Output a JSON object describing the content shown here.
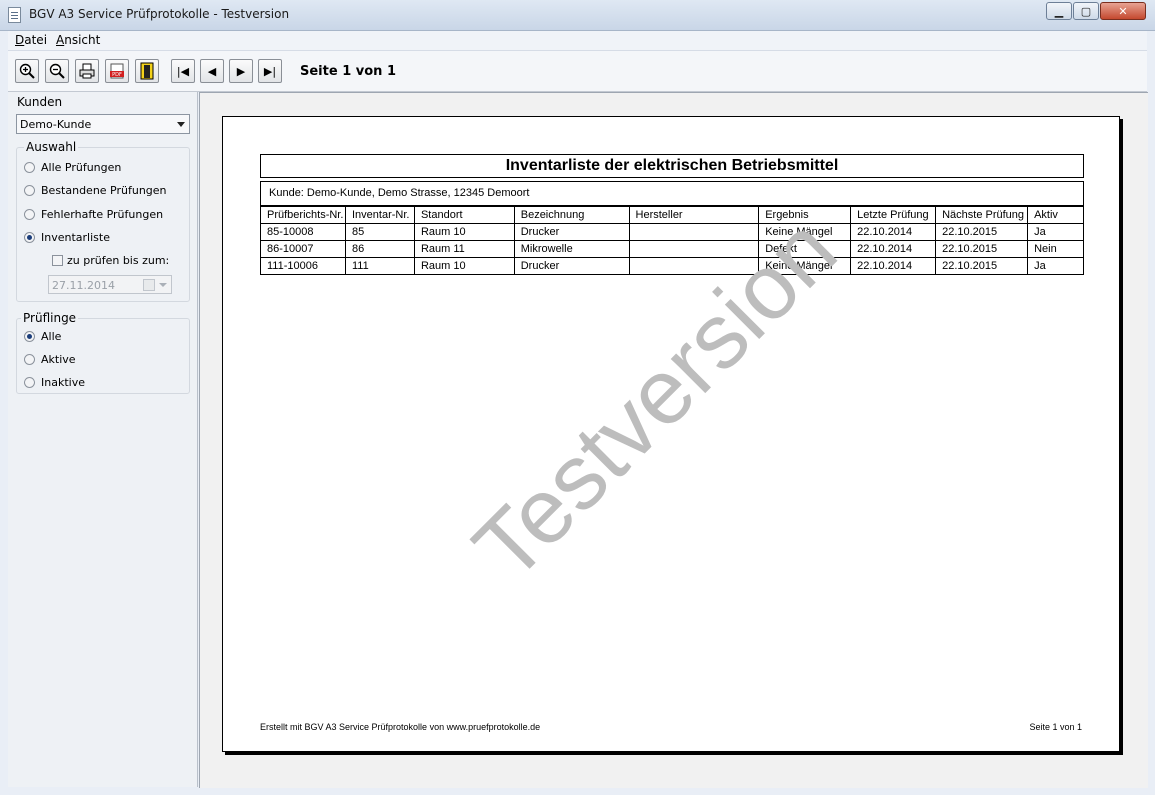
{
  "window": {
    "title": "BGV A3 Service Prüfprotokolle - Testversion",
    "controls": {
      "minimize": "▁",
      "maximize": "▢",
      "close": "✕"
    }
  },
  "menu": {
    "items": [
      {
        "label_first": "D",
        "label_rest": "atei"
      },
      {
        "label_first": "A",
        "label_rest": "nsicht"
      }
    ]
  },
  "toolbar": {
    "buttons": [
      {
        "icon": "zoom-in-icon",
        "glyph": "⊕"
      },
      {
        "icon": "zoom-out-icon",
        "glyph": "⊖"
      },
      {
        "icon": "print-icon",
        "glyph": "🖶"
      },
      {
        "icon": "pdf-export-icon",
        "glyph": "PDF"
      },
      {
        "icon": "exit-door-icon",
        "glyph": "▮"
      }
    ],
    "nav": {
      "first": "|◀",
      "prev": "◀",
      "next": "▶",
      "last": "▶|"
    },
    "page_label": "Seite 1 von 1"
  },
  "sidebar": {
    "kunden_label": "Kunden",
    "kunde_selected": "Demo-Kunde",
    "auswahl_label": "Auswahl",
    "auswahl_options": [
      "Alle Prüfungen",
      "Bestandene Prüfungen",
      "Fehlerhafte Prüfungen",
      "Inventarliste"
    ],
    "auswahl_selected": 3,
    "zu_pruefen_label": "zu prüfen bis zum:",
    "zu_pruefen_checked": false,
    "date_value": "27.11.2014",
    "prueflinge_label": "Prüflinge",
    "prueflinge_options": [
      "Alle",
      "Aktive",
      "Inaktive"
    ],
    "prueflinge_selected": 0
  },
  "report": {
    "title": "Inventarliste der elektrischen Betriebsmittel",
    "kunde_line": "Kunde: Demo-Kunde, Demo Strasse, 12345 Demoort",
    "columns": [
      "Prüfberichts-Nr.",
      "Inventar-Nr.",
      "Standort",
      "Bezeichnung",
      "Hersteller",
      "Ergebnis",
      "Letzte Prüfung",
      "Nächste Prüfung",
      "Aktiv"
    ],
    "rows": [
      [
        "85-10008",
        "85",
        "Raum 10",
        "Drucker",
        "",
        "Keine Mängel",
        "22.10.2014",
        "22.10.2015",
        "Ja"
      ],
      [
        "86-10007",
        "86",
        "Raum 11",
        "Mikrowelle",
        "",
        "Defekt",
        "22.10.2014",
        "22.10.2015",
        "Nein"
      ],
      [
        "111-10006",
        "111",
        "Raum 10",
        "Drucker",
        "",
        "Keine Mängel",
        "22.10.2014",
        "22.10.2015",
        "Ja"
      ]
    ],
    "watermark": "Testversion",
    "footer_left": "Erstellt mit BGV A3 Service Prüfprotokolle von www.pruefprotokolle.de",
    "footer_right": "Seite 1 von 1"
  }
}
